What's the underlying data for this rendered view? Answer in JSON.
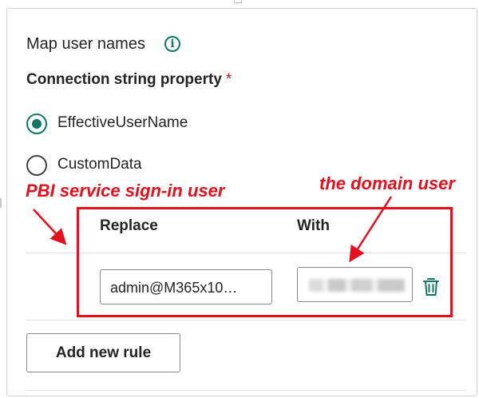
{
  "section": {
    "title": "Map user names",
    "info_icon": "info-icon"
  },
  "connection_property": {
    "label": "Connection string property",
    "required_marker": "*",
    "options": [
      {
        "label": "EffectiveUserName",
        "selected": true
      },
      {
        "label": "CustomData",
        "selected": false
      }
    ]
  },
  "rules_table": {
    "headers": {
      "replace": "Replace",
      "with": "With"
    },
    "rows": [
      {
        "replace_value": "admin@M365x10…",
        "with_value": "",
        "delete_icon": "trash-icon"
      }
    ]
  },
  "add_rule_button": "Add new rule",
  "annotations": {
    "left": "PBI service sign-in user",
    "right": "the domain user",
    "color": "#e3101e"
  },
  "colors": {
    "accent": "#117865",
    "required": "#c50f1f"
  }
}
